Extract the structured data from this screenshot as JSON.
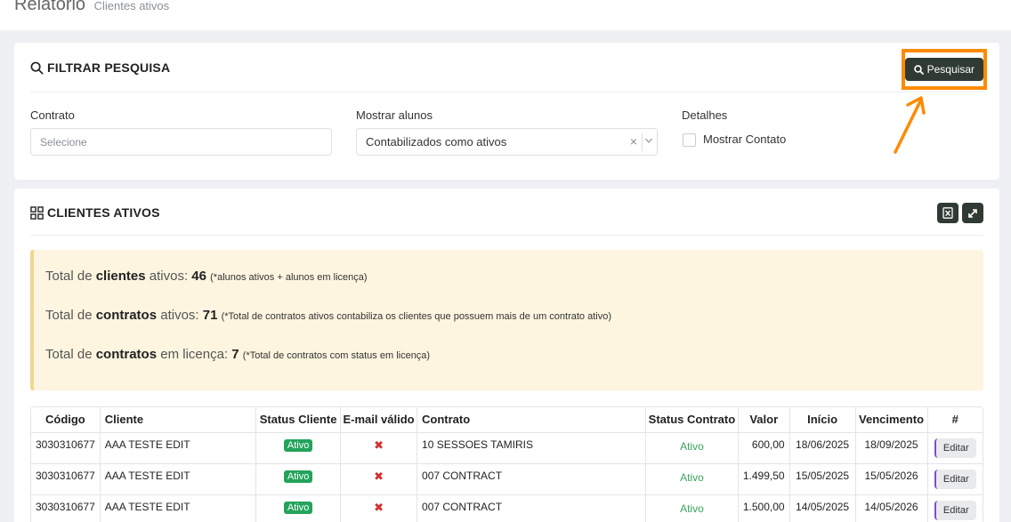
{
  "page": {
    "title": "Relatório",
    "subtitle": "Clientes ativos"
  },
  "filter": {
    "title": "FILTRAR PESQUISA",
    "search_button": "Pesquisar",
    "contract_label": "Contrato",
    "contract_placeholder": "Selecione",
    "students_label": "Mostrar alunos",
    "students_value": "Contabilizados como ativos",
    "clear_glyph": "×",
    "details_label": "Detalhes",
    "show_contact_label": "Mostrar Contato"
  },
  "clients": {
    "title": "CLIENTES ATIVOS",
    "icons": [
      "excel-export-icon",
      "expand-icon"
    ]
  },
  "summary": {
    "line1": {
      "prefix": "Total de ",
      "bold": "clientes",
      "suffix": " ativos: ",
      "value": "46",
      "note": "(*alunos ativos + alunos em licença)"
    },
    "line2": {
      "prefix": "Total de ",
      "bold": "contratos",
      "suffix": " ativos: ",
      "value": "71",
      "note": "(*Total de contratos ativos contabiliza os clientes que possuem mais de um contrato ativo)"
    },
    "line3": {
      "prefix": "Total de ",
      "bold": "contratos",
      "suffix": " em licença: ",
      "value": "7",
      "note": "(*Total de contratos com status em licença)"
    }
  },
  "table": {
    "headers": [
      "Código",
      "Cliente",
      "Status Cliente",
      "E-mail válido",
      "Contrato",
      "Status Contrato",
      "Valor",
      "Início",
      "Vencimento",
      "#"
    ],
    "invalid_glyph": "✖",
    "edit_label": "Editar",
    "rows": [
      {
        "codigo": "3030310677",
        "cliente": "AAA TESTE EDIT",
        "status_cliente": "Ativo",
        "contrato": "10 SESSOES TAMIRIS",
        "status_contrato": "Ativo",
        "valor": "600,00",
        "inicio": "18/06/2025",
        "vencimento": "18/09/2025"
      },
      {
        "codigo": "3030310677",
        "cliente": "AAA TESTE EDIT",
        "status_cliente": "Ativo",
        "contrato": "007 CONTRACT",
        "status_contrato": "Ativo",
        "valor": "1.499,50",
        "inicio": "15/05/2025",
        "vencimento": "15/05/2026"
      },
      {
        "codigo": "3030310677",
        "cliente": "AAA TESTE EDIT",
        "status_cliente": "Ativo",
        "contrato": "007 CONTRACT",
        "status_contrato": "Ativo",
        "valor": "1.500,00",
        "inicio": "14/05/2025",
        "vencimento": "14/05/2026"
      }
    ]
  },
  "colors": {
    "accent_dark": "#2f3a33",
    "highlight": "#ff8a00",
    "success": "#23a35b",
    "error": "#d32f2f"
  }
}
